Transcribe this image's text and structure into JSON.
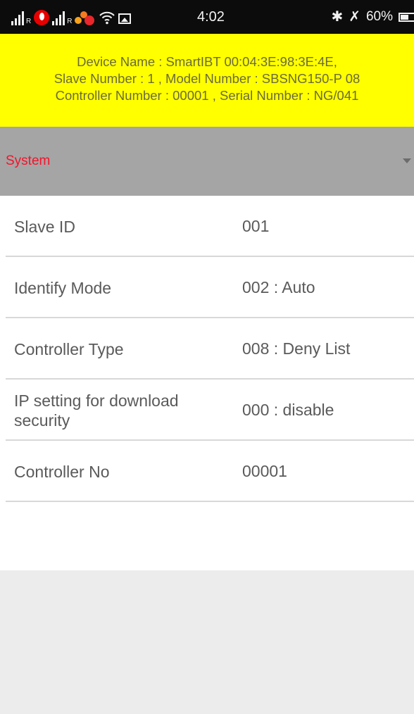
{
  "status_bar": {
    "signal_1_tiny": "R",
    "signal_2_tiny": "R",
    "time": "4:02",
    "battery_percent": "60%",
    "icons": [
      "signal-icon",
      "vodafone-icon",
      "signal-icon",
      "app-notification-icon",
      "wifi-icon",
      "image-icon",
      "bluetooth-icon",
      "mute-icon",
      "battery-icon"
    ]
  },
  "device_info": {
    "line1": "Device Name  : SmartIBT 00:04:3E:98:3E:4E,",
    "line2": "Slave Number : 1 , Model Number :   SBSNG150-P 08",
    "line3": "Controller Number : 00001 , Serial Number : NG/041"
  },
  "spinner": {
    "selected": "System",
    "arrow_icon": "dropdown-arrow-icon"
  },
  "settings": [
    {
      "label": "Slave ID",
      "value": "001"
    },
    {
      "label": "Identify Mode",
      "value": "002 : Auto"
    },
    {
      "label": "Controller Type",
      "value": "008 : Deny List"
    },
    {
      "label": "IP setting for download security",
      "value": "000 : disable"
    },
    {
      "label": "Controller No",
      "value": "00001"
    }
  ],
  "colors": {
    "status_bar_bg": "#0c0c0c",
    "header_bg": "#ffff00",
    "spinner_bg": "#a5a5a5",
    "spinner_text": "#f2152d",
    "list_bg": "#ffffff",
    "page_bg": "#ececec"
  }
}
